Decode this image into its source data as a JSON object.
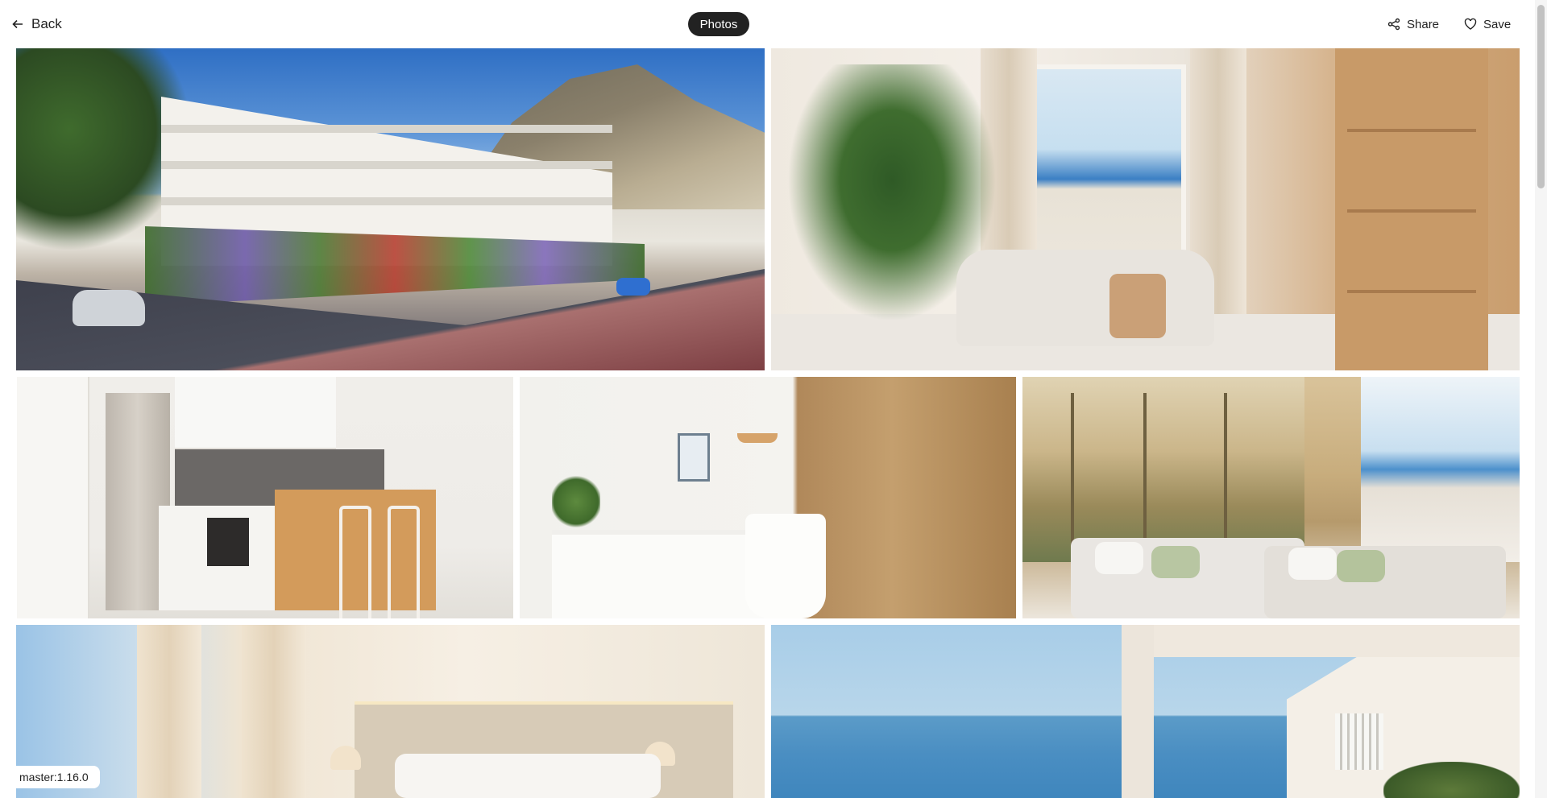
{
  "header": {
    "back_label": "Back",
    "photos_label": "Photos",
    "share_label": "Share",
    "save_label": "Save",
    "icons": {
      "back": "arrow-left-icon",
      "share": "share-icon",
      "save": "heart-icon"
    }
  },
  "gallery": {
    "photos": [
      {
        "subject": "exterior-building"
      },
      {
        "subject": "living-room"
      },
      {
        "subject": "kitchen"
      },
      {
        "subject": "bathroom"
      },
      {
        "subject": "bedroom-mural"
      },
      {
        "subject": "bedroom"
      },
      {
        "subject": "terrace-sea-view"
      }
    ]
  },
  "footer": {
    "version": "master:1.16.0"
  },
  "colors": {
    "pill_background": "#222222",
    "pill_text": "#ffffff",
    "text": "#222222"
  }
}
